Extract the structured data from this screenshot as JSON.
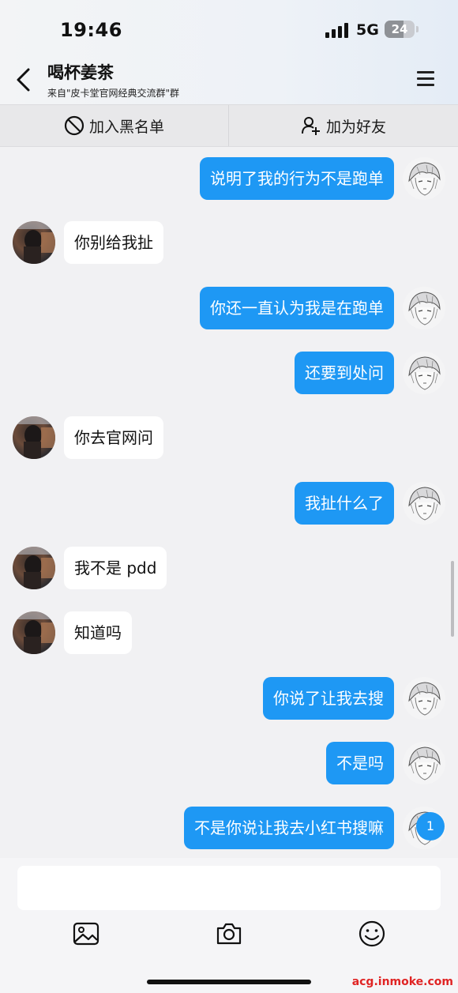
{
  "status_bar": {
    "time": "19:46",
    "network": "5G",
    "battery": "24"
  },
  "header": {
    "title": "喝杯姜茶",
    "subtitle": "来自\"皮卡堂官网经典交流群\"群"
  },
  "actions": {
    "blacklist": "加入黑名单",
    "add_friend": "加为好友"
  },
  "messages": [
    {
      "dir": "out",
      "text": "说明了我的行为不是跑单"
    },
    {
      "dir": "in",
      "text": "你别给我扯"
    },
    {
      "dir": "out",
      "text": "你还一直认为我是在跑单"
    },
    {
      "dir": "out",
      "text": "还要到处问"
    },
    {
      "dir": "in",
      "text": "你去官网问"
    },
    {
      "dir": "out",
      "text": "我扯什么了"
    },
    {
      "dir": "in",
      "text": "我不是 pdd"
    },
    {
      "dir": "in",
      "text": "知道吗"
    },
    {
      "dir": "out",
      "text": "你说了让我去搜"
    },
    {
      "dir": "out",
      "text": "不是吗"
    },
    {
      "dir": "out",
      "text": "不是你说让我去小红书搜嘛"
    }
  ],
  "unread_badge": "1",
  "composer": {
    "tools": [
      "image-icon",
      "camera-icon",
      "emoji-icon"
    ]
  },
  "watermark": "acg.inmoke.com",
  "colors": {
    "accent": "#1e98f4",
    "background": "#f1f1f3"
  }
}
